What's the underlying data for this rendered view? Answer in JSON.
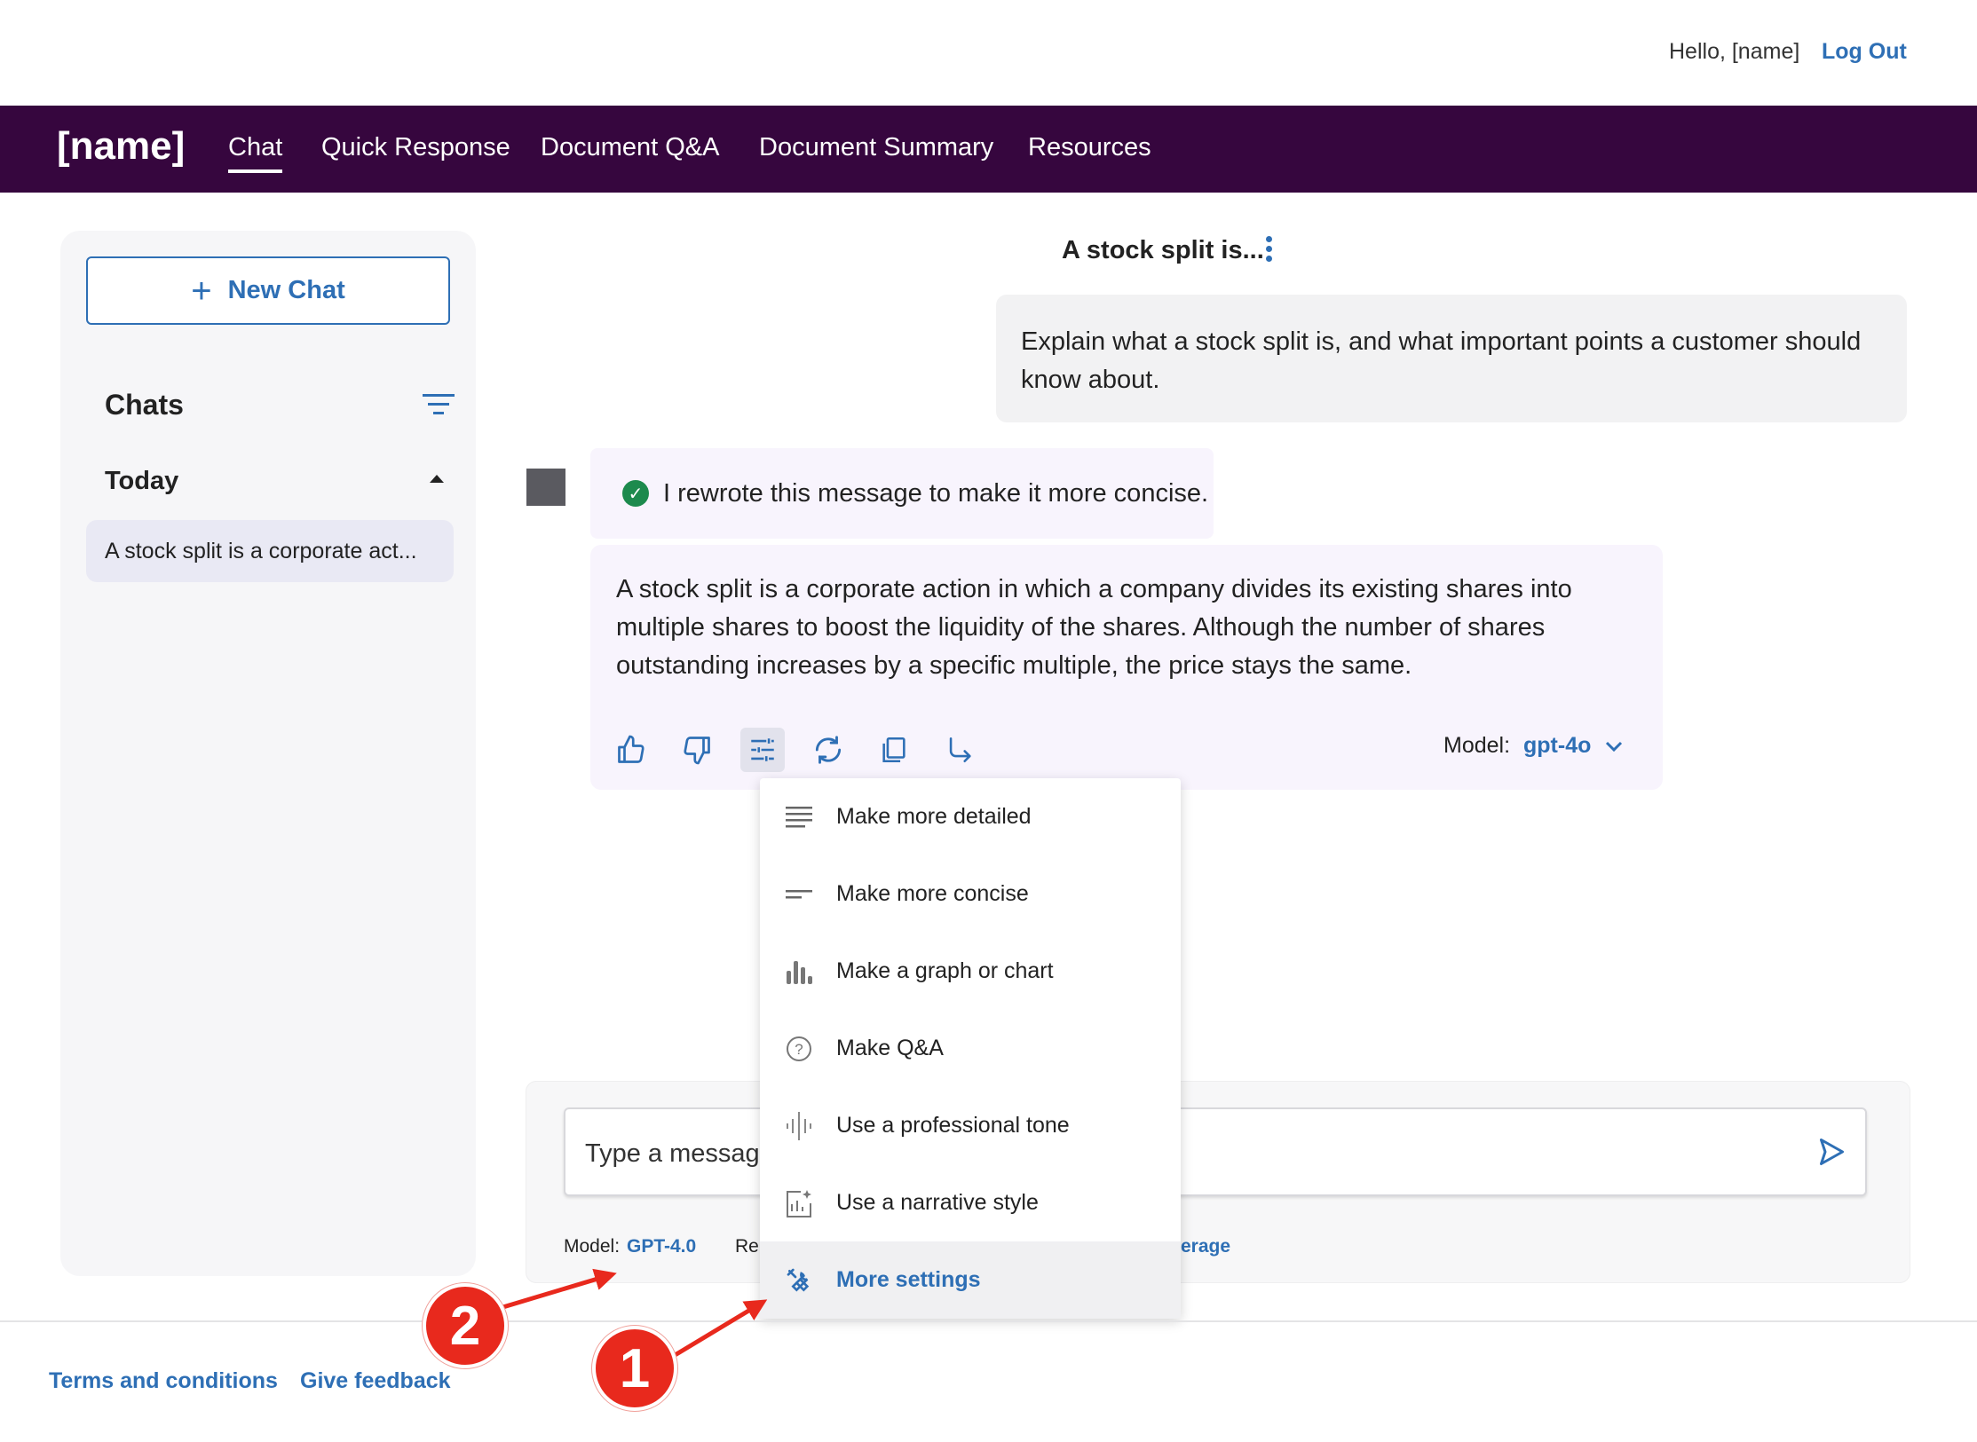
{
  "header": {
    "greeting": "Hello, [name]",
    "logout": "Log Out"
  },
  "nav": {
    "brand": "[name]",
    "items": [
      {
        "label": "Chat",
        "active": true
      },
      {
        "label": "Quick Response"
      },
      {
        "label": "Document Q&A"
      },
      {
        "label": "Document Summary"
      },
      {
        "label": "Resources"
      }
    ],
    "background": "#36063e"
  },
  "sidebar": {
    "new_chat": "New Chat",
    "chats_title": "Chats",
    "group": "Today",
    "items": [
      {
        "label": "A stock split is a corporate  act..."
      }
    ]
  },
  "conversation": {
    "title": "A stock split is...",
    "user_message": "Explain what a stock split is, and what important points a customer should know about.",
    "notice": "I rewrote this message to make it more concise.",
    "answer": "A stock split is a corporate action in which a company divides its existing shares into multiple shares to boost the liquidity of the shares. Although the number of shares outstanding increases by a specific multiple, the price stays the same.",
    "model_label": "Model:",
    "model_value": "gpt-4o",
    "toolbar_icons": [
      "thumbs-up-icon",
      "thumbs-down-icon",
      "sliders-icon",
      "refresh-icon",
      "copy-icon",
      "forward-icon"
    ]
  },
  "menu": {
    "items": [
      {
        "label": "Make more detailed",
        "icon": "lines-icon"
      },
      {
        "label": "Make more concise",
        "icon": "short-lines-icon"
      },
      {
        "label": "Make a graph or chart",
        "icon": "bar-chart-icon"
      },
      {
        "label": "Make Q&A",
        "icon": "question-circle-icon"
      },
      {
        "label": "Use a professional tone",
        "icon": "audio-wave-icon"
      },
      {
        "label": "Use a narrative style",
        "icon": "magic-edit-icon"
      },
      {
        "label": "More settings",
        "icon": "tools-icon",
        "highlighted": true
      }
    ]
  },
  "composer": {
    "placeholder": "Type a message",
    "model_label": "Model:",
    "model_value": "GPT-4.0",
    "re_fragment": "Re",
    "erage_fragment": "erage"
  },
  "footer": {
    "terms": "Terms and conditions",
    "feedback": "Give feedback"
  },
  "annotations": {
    "badge_1": "1",
    "badge_2": "2",
    "color": "#e8291d"
  },
  "colors": {
    "accent": "#2e6fb5",
    "success": "#1d8a4d",
    "bubble": "#f8f4fd"
  }
}
